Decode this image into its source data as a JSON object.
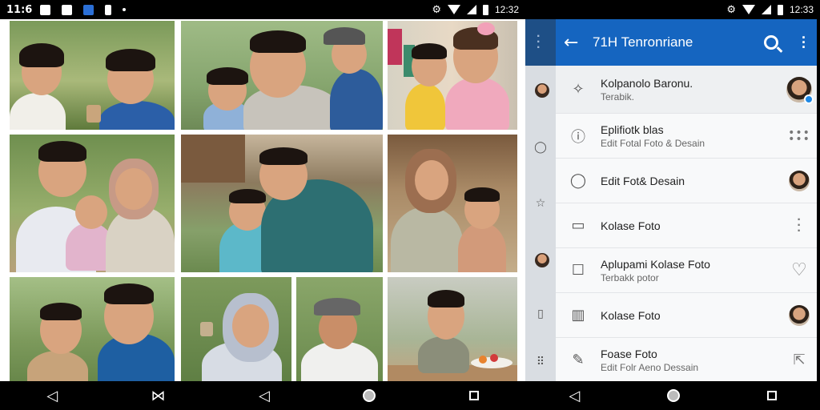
{
  "left_screen": {
    "status_time": "11:6",
    "status_clock": "12:32",
    "photos": [
      {
        "name": "photo-boy-plant"
      },
      {
        "name": "photo-family-park"
      },
      {
        "name": "photo-kids-market"
      },
      {
        "name": "photo-father-mother-child"
      },
      {
        "name": "photo-father-child-village"
      },
      {
        "name": "photo-mother-child-porch"
      },
      {
        "name": "photo-father-son"
      },
      {
        "name": "photo-woman-hijab"
      },
      {
        "name": "photo-man-cap"
      },
      {
        "name": "photo-child-table"
      }
    ],
    "nav": {
      "back": "◁",
      "middle": "⋈"
    }
  },
  "right_screen": {
    "status_clock": "12:33",
    "appbar": {
      "title": "71H Tenronriane"
    },
    "list": [
      {
        "icon": "magic-wand-icon",
        "glyph": "⁄",
        "title": "Kolpanolo Baronu.",
        "subtitle": "Terabik.",
        "trail": "avatar-badge"
      },
      {
        "icon": "info-icon",
        "glyph": "ⓘ",
        "title": "Eplifiotk blas",
        "subtitle": "Edit Fotal Foto & Desain",
        "trail": "dots-grid"
      },
      {
        "icon": "chat-icon",
        "glyph": "◯",
        "title": "Edit Fot& Desain",
        "subtitle": "",
        "trail": "avatar"
      },
      {
        "icon": "image-icon",
        "glyph": "▭",
        "title": "Kolase Foto",
        "subtitle": "",
        "trail": "vdots"
      },
      {
        "icon": "square-icon",
        "glyph": "☐",
        "title": "Aplupami Kolase Foto",
        "subtitle": "Terbakk potor",
        "trail": "heart"
      },
      {
        "icon": "chart-icon",
        "glyph": "▥",
        "title": "Kolase Foto",
        "subtitle": "",
        "trail": "avatar"
      },
      {
        "icon": "edit-icon",
        "glyph": "✎",
        "title": "Foase Foto",
        "subtitle": "Edit Folr Aeno Dessain",
        "trail": "share"
      }
    ],
    "heart_glyph": "♡",
    "share_glyph": "⇱",
    "nav": {
      "back": "◁"
    }
  }
}
